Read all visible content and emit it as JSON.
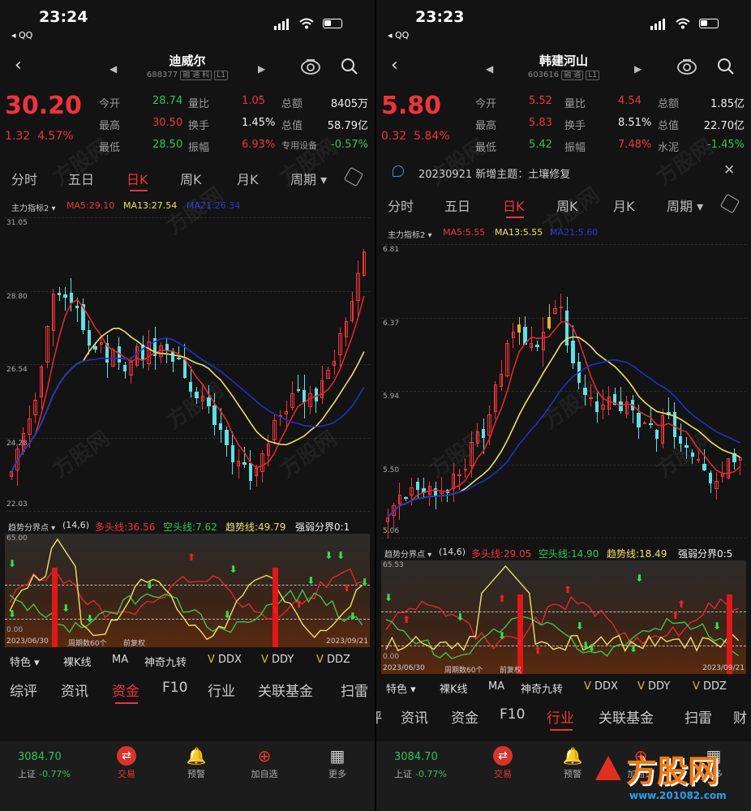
{
  "left": {
    "status": {
      "time": "23:24",
      "back_app": "◂ QQ"
    },
    "nav": {
      "name": "迪威尔",
      "code": "688377",
      "tags": "融 通 科",
      "level": "L1"
    },
    "price": "30.20",
    "change": "1.32",
    "change_pct": "4.57%",
    "quotes": [
      {
        "l1": "今开",
        "v1": "28.74",
        "c1": "green",
        "l2": "量比",
        "v2": "1.05",
        "c2": "red",
        "l3": "总额",
        "v3": "8405万",
        "c3": "white"
      },
      {
        "l1": "最高",
        "v1": "30.50",
        "c1": "red",
        "l2": "换手",
        "v2": "1.45%",
        "c2": "white",
        "l3": "总值",
        "v3": "58.79亿",
        "c3": "white"
      },
      {
        "l1": "最低",
        "v1": "28.50",
        "c1": "green",
        "l2": "振幅",
        "v2": "6.93%",
        "c2": "red",
        "l3": "专用设备",
        "v3": "-0.57%",
        "c3": "green"
      }
    ],
    "notice": null,
    "period_tabs": [
      "分时",
      "五日",
      "日K",
      "周K",
      "月K",
      "周期 ▾"
    ],
    "indicator": {
      "name": "主力指标2 ▾",
      "ma5": "MA5:29.10",
      "ma13": "MA13:27.54",
      "ma21": "MA21:26.34"
    },
    "y_axis": [
      "31.05",
      "28.80",
      "26.54",
      "24.28",
      "22.03"
    ],
    "sub": {
      "name": "趋势分界点 ▾",
      "params": "(14,6)",
      "s1": "多头线:36.56",
      "s2": "空头线:7.62",
      "s3": "趋势线:49.79",
      "s4": "强弱分界0:1",
      "top": "65.00",
      "bottom": "0.00",
      "date_start": "2023/06/30",
      "period_count": "周期数60个",
      "fq": "前复权",
      "date_end": "2023/09/21"
    },
    "tools": [
      "特色 ▾",
      "裸K线",
      "MA",
      "神奇九转",
      "DDX",
      "DDY",
      "DDZ"
    ],
    "bottom_tabs": [
      "综评",
      "资讯",
      "资金",
      "F10",
      "行业",
      "关联基金",
      "扫雷"
    ],
    "bottom_active": 2,
    "dock": {
      "index_val": "3084.70",
      "index_name": "上证",
      "index_chg": "-0.77%",
      "items": [
        "交易",
        "预警",
        "加自选",
        "更多"
      ]
    }
  },
  "right": {
    "status": {
      "time": "23:23",
      "back_app": "◂ QQ"
    },
    "nav": {
      "name": "韩建河山",
      "code": "603616",
      "tags": "融 通",
      "level": "L1"
    },
    "price": "5.80",
    "change": "0.32",
    "change_pct": "5.84%",
    "quotes": [
      {
        "l1": "今开",
        "v1": "5.52",
        "c1": "red",
        "l2": "量比",
        "v2": "4.54",
        "c2": "red",
        "l3": "总额",
        "v3": "1.85亿",
        "c3": "white"
      },
      {
        "l1": "最高",
        "v1": "5.83",
        "c1": "red",
        "l2": "换手",
        "v2": "8.51%",
        "c2": "white",
        "l3": "总值",
        "v3": "22.70亿",
        "c3": "white"
      },
      {
        "l1": "最低",
        "v1": "5.42",
        "c1": "green",
        "l2": "振幅",
        "v2": "7.48%",
        "c2": "red",
        "l3": "水泥",
        "v3": "-1.45%",
        "c3": "green"
      }
    ],
    "notice": "20230921 新增主题：土壤修复",
    "period_tabs": [
      "分时",
      "五日",
      "日K",
      "周K",
      "月K",
      "周期 ▾"
    ],
    "indicator": {
      "name": "主力指标2 ▾",
      "ma5": "MA5:5.55",
      "ma13": "MA13:5.55",
      "ma21": "MA21:5.60"
    },
    "y_axis": [
      "6.81",
      "6.37",
      "5.94",
      "5.50",
      "5.06"
    ],
    "sub": {
      "name": "趋势分界点 ▾",
      "params": "(14,6)",
      "s1": "多头线:29.05",
      "s2": "空头线:14.90",
      "s3": "趋势线:18.49",
      "s4": "强弱分界0:5",
      "top": "65.53",
      "bottom": "0.00",
      "date_start": "2023/06/30",
      "period_count": "周期数60个",
      "fq": "前复权",
      "date_end": "2023/09/21"
    },
    "tools": [
      "特色 ▾",
      "裸K线",
      "MA",
      "神奇九转",
      "DDX",
      "DDY",
      "DDZ"
    ],
    "bottom_tabs": [
      "评",
      "资讯",
      "资金",
      "F10",
      "行业",
      "关联基金",
      "扫雷",
      "财"
    ],
    "bottom_active": 4,
    "dock": {
      "index_val": "3084.70",
      "index_name": "上证",
      "index_chg": "-0.77%",
      "items": [
        "交易",
        "预警",
        "加自选",
        "更多"
      ]
    }
  },
  "watermark": {
    "brand": "方股网",
    "url": "www.201082.com"
  },
  "colors": {
    "up": "#f0333a",
    "down": "#5fe0e6",
    "ma5": "#e02828",
    "ma13": "#f0e060",
    "ma21": "#2030c8",
    "panel_bg": "#131313"
  }
}
